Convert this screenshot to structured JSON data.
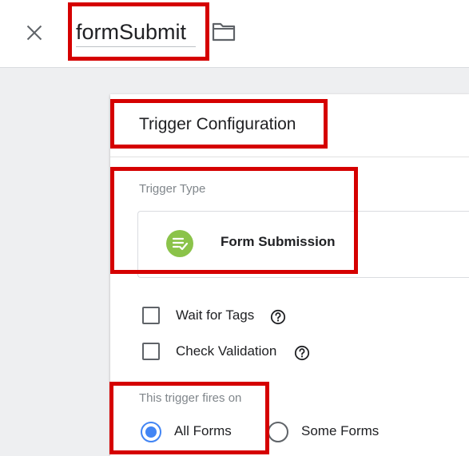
{
  "header": {
    "trigger_name": "formSubmit"
  },
  "panel": {
    "title": "Trigger Configuration",
    "trigger_type_label": "Trigger Type",
    "trigger_type_name": "Form Submission",
    "options": {
      "wait_for_tags": "Wait for Tags",
      "check_validation": "Check Validation"
    },
    "fires_on_label": "This trigger fires on",
    "fires_on_options": {
      "all": "All Forms",
      "some": "Some Forms"
    },
    "fires_on_selected": "All Forms"
  },
  "colors": {
    "highlight": "#d50000",
    "trigger_icon": "#8bc34a",
    "radio_accent": "#4285f4"
  }
}
